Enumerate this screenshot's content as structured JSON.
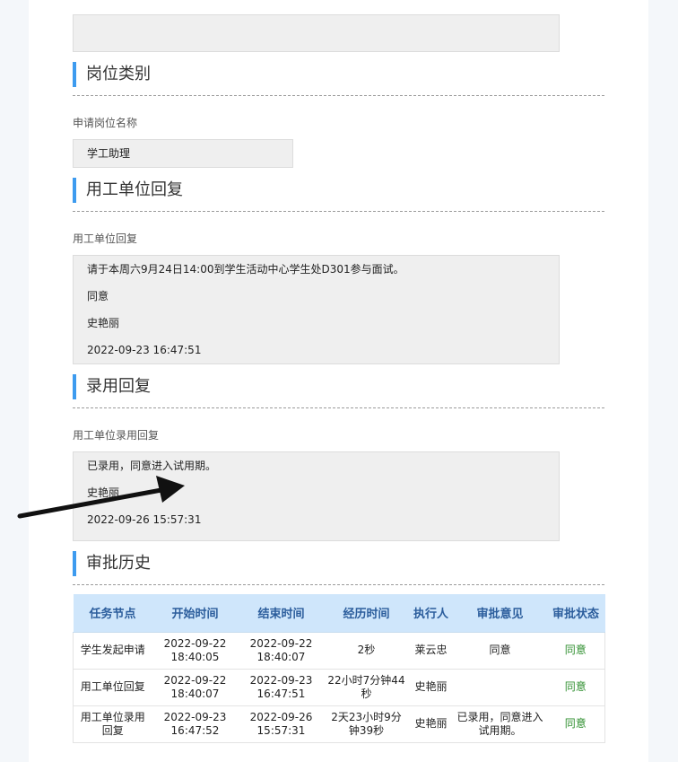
{
  "sections": {
    "position_type": {
      "title": "岗位类别"
    },
    "unit_reply": {
      "title": "用工单位回复"
    },
    "hire_reply": {
      "title": "录用回复"
    },
    "approval_history": {
      "title": "审批历史"
    }
  },
  "position": {
    "label": "申请岗位名称",
    "value": "学工助理"
  },
  "unit_reply": {
    "label": "用工单位回复",
    "lines": [
      "请于本周六9月24日14:00到学生活动中心学生处D301参与面试。",
      "同意",
      "史艳丽",
      "2022-09-23 16:47:51"
    ]
  },
  "hire_reply": {
    "label": "用工单位录用回复",
    "lines": [
      "已录用，同意进入试用期。",
      "史艳丽",
      "2022-09-26 15:57:31"
    ]
  },
  "history": {
    "columns": [
      "任务节点",
      "开始时间",
      "结束时间",
      "经历时间",
      "执行人",
      "审批意见",
      "审批状态"
    ],
    "rows": [
      {
        "node": "学生发起申请",
        "start": "2022-09-22 18:40:05",
        "end": "2022-09-22 18:40:07",
        "duration": "2秒",
        "executor": "莱云忠",
        "opinion": "同意",
        "status": "同意"
      },
      {
        "node": "用工单位回复",
        "start": "2022-09-22 18:40:07",
        "end": "2022-09-23 16:47:51",
        "duration": "22小时7分钟44秒",
        "executor": "史艳丽",
        "opinion": "",
        "status": "同意"
      },
      {
        "node": "用工单位录用回复",
        "start": "2022-09-23 16:47:52",
        "end": "2022-09-26 15:57:31",
        "duration": "2天23小时9分钟39秒",
        "executor": "史艳丽",
        "opinion": "已录用，同意进入试用期。",
        "status": "同意"
      }
    ]
  },
  "colors": {
    "accent_bar": "#3d9bef",
    "table_header_bg": "#cfe6fb",
    "status_green": "#2f8f2f"
  }
}
